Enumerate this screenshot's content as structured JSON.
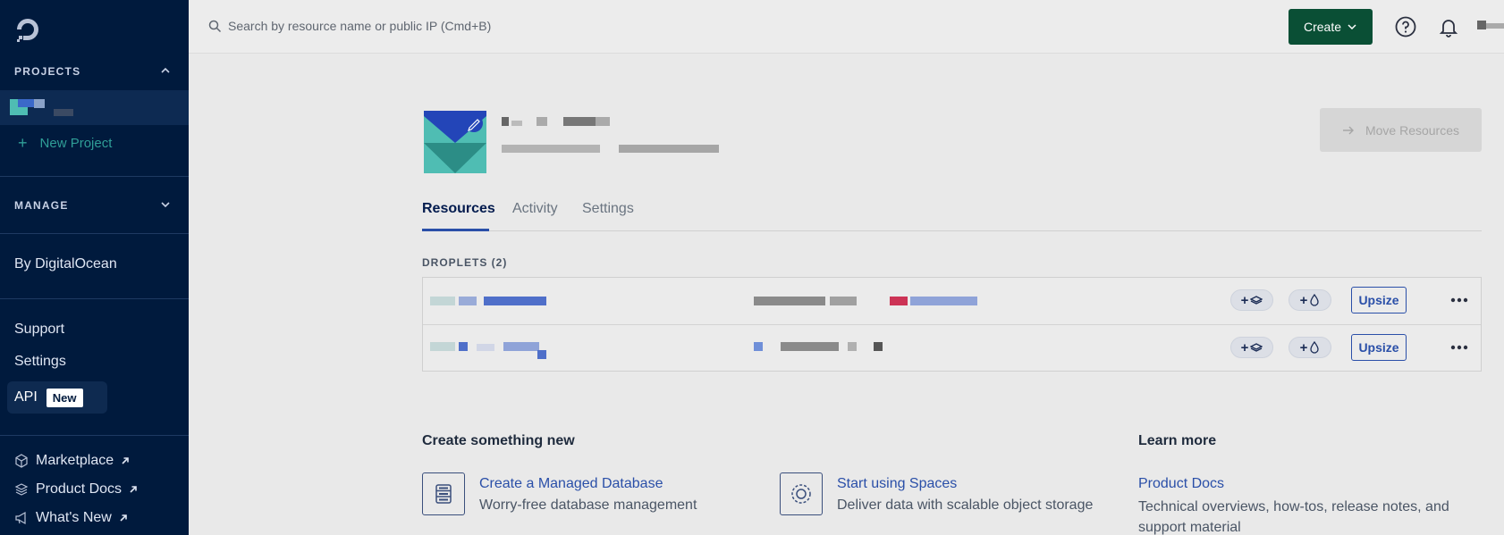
{
  "sidebar": {
    "projects_heading": "PROJECTS",
    "new_project": "New Project",
    "manage_heading": "MANAGE",
    "by_digitalocean": "By DigitalOcean",
    "support": "Support",
    "settings": "Settings",
    "api": "API",
    "api_badge": "New",
    "marketplace": "Marketplace",
    "product_docs": "Product Docs",
    "whats_new": "What's New"
  },
  "topbar": {
    "search_placeholder": "Search by resource name or public IP (Cmd+B)",
    "create_label": "Create"
  },
  "project": {
    "move_resources": "Move Resources",
    "tabs": [
      "Resources",
      "Activity",
      "Settings"
    ],
    "active_tab": "Resources"
  },
  "droplets": {
    "heading": "DROPLETS (2)",
    "upsize_label": "Upsize",
    "rows": 2
  },
  "create_section": {
    "heading": "Create something new",
    "items": [
      {
        "title": "Create a Managed Database",
        "desc": "Worry-free database management",
        "icon": "database-icon"
      },
      {
        "title": "Start using Spaces",
        "desc": "Deliver data with scalable object storage",
        "icon": "spaces-icon"
      }
    ]
  },
  "learn_section": {
    "heading": "Learn more",
    "link": "Product Docs",
    "desc": "Technical overviews, how-tos, release notes, and support material"
  },
  "colors": {
    "sidebar_bg": "#001a3d",
    "accent_teal": "#2f9e97",
    "create_green": "#0a4f35",
    "link_blue": "#2a4fa8"
  }
}
